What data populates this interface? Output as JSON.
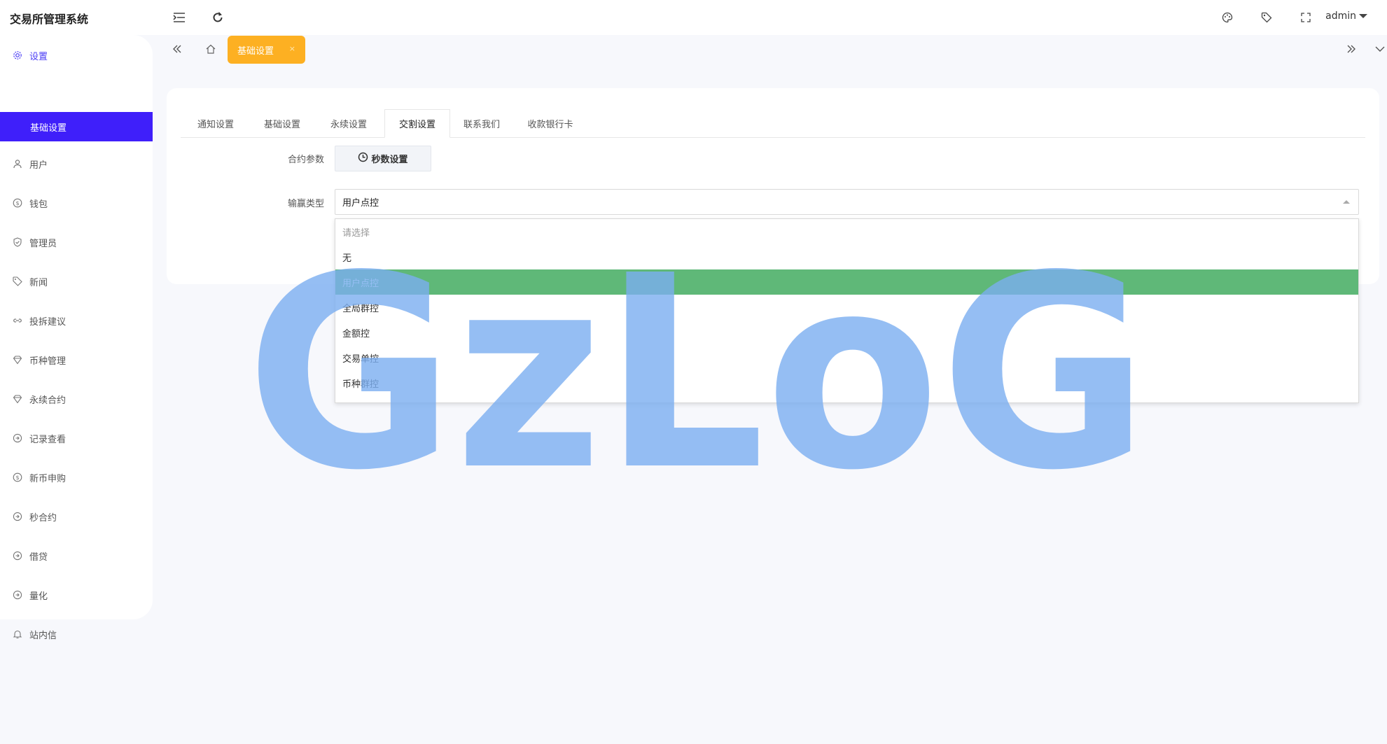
{
  "app": {
    "title": "交易所管理系统"
  },
  "header": {
    "user": "admin"
  },
  "sidebar": {
    "items": [
      {
        "label": "设置",
        "icon": "gear-icon"
      },
      {
        "label": "基础设置",
        "icon": ""
      },
      {
        "label": "用户",
        "icon": "user-icon"
      },
      {
        "label": "钱包",
        "icon": "dollar-icon"
      },
      {
        "label": "管理员",
        "icon": "shield-icon"
      },
      {
        "label": "新闻",
        "icon": "tag-icon"
      },
      {
        "label": "投拆建议",
        "icon": "link-icon"
      },
      {
        "label": "币种管理",
        "icon": "diamond-icon"
      },
      {
        "label": "永续合约",
        "icon": "diamond-icon"
      },
      {
        "label": "记录查看",
        "icon": "cycle-icon"
      },
      {
        "label": "新币申购",
        "icon": "dollar-icon"
      },
      {
        "label": "秒合约",
        "icon": "cycle-icon"
      },
      {
        "label": "借贷",
        "icon": "cycle-icon"
      },
      {
        "label": "量化",
        "icon": "cycle-icon"
      },
      {
        "label": "站内信",
        "icon": "bell-icon"
      }
    ]
  },
  "page_tab": {
    "label": "基础设置",
    "close": "×"
  },
  "tabs": [
    "通知设置",
    "基础设置",
    "永续设置",
    "交割设置",
    "联系我们",
    "收款银行卡"
  ],
  "form": {
    "contract_label": "合约参数",
    "seconds_button": "秒数设置",
    "winloss_label": "输赢类型",
    "winloss_value": "用户点控",
    "options": [
      "请选择",
      "无",
      "用户点控",
      "全局群控",
      "金额控",
      "交易单控",
      "币种群控"
    ],
    "selected_option": "用户点控"
  },
  "watermark": {
    "text": "GzLoG",
    "color": "#7aaef0"
  },
  "colors": {
    "accent": "#3f1ffa",
    "tab_highlight": "#fdb022",
    "selected_option": "#5fb878"
  }
}
